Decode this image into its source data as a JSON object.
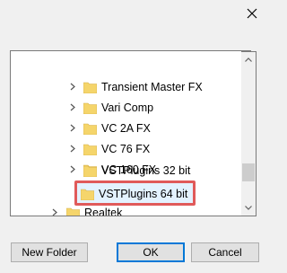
{
  "tree": {
    "items": [
      {
        "label": "Transient Master FX",
        "expander": true
      },
      {
        "label": "Vari Comp",
        "expander": true
      },
      {
        "label": "VC 2A FX",
        "expander": true
      },
      {
        "label": "VC 76 FX",
        "expander": true
      },
      {
        "label": "VC 160 FX",
        "expander": true
      },
      {
        "label": "VSTPlugins 32 bit",
        "expander": false
      },
      {
        "label": "VSTPlugins 64 bit",
        "expander": false,
        "selected": true
      },
      {
        "label": "Realtek",
        "expander": true
      }
    ]
  },
  "buttons": {
    "new_folder": "New Folder",
    "ok": "OK",
    "cancel": "Cancel"
  },
  "colors": {
    "highlight_border": "#e05a5a",
    "selection_fill": "#cce8ff",
    "folder_yellow": "#f5d56b",
    "default_button_border": "#0078d7"
  }
}
